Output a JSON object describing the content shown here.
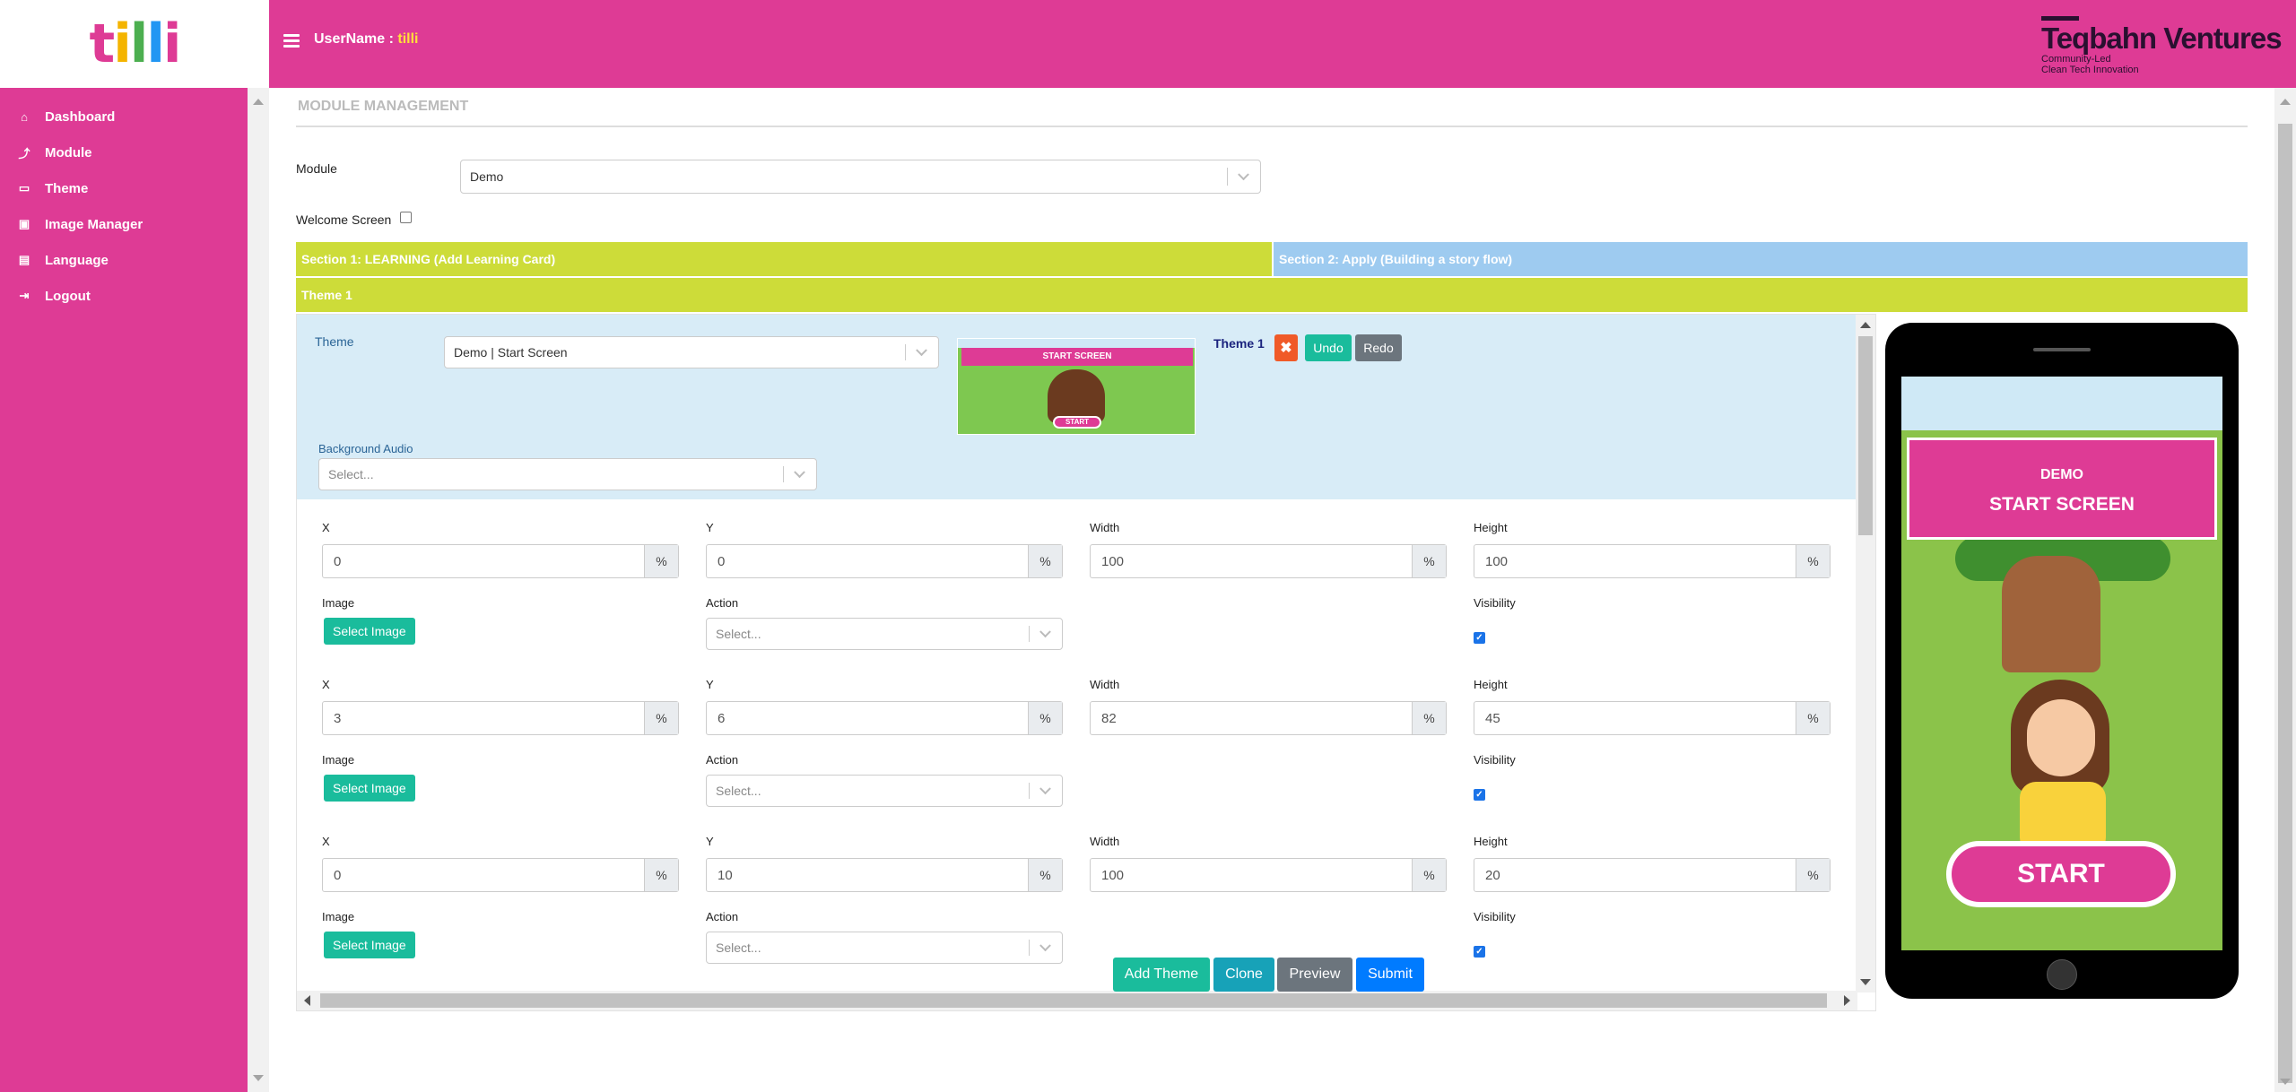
{
  "brand": {
    "logo_letters": [
      "t",
      "i",
      "l",
      "l",
      "i"
    ],
    "logo_colors": [
      "#de3b95",
      "#f4b400",
      "#4caf50",
      "#2196f3",
      "#de3b95"
    ],
    "company_name": "Teqbahn Ventures",
    "company_tagline_1": "Community-Led",
    "company_tagline_2": "Clean Tech Innovation"
  },
  "header": {
    "username_label": "UserName : ",
    "username_value": "tilli"
  },
  "sidebar": {
    "items": [
      {
        "label": "Dashboard",
        "icon": "home-icon"
      },
      {
        "label": "Module",
        "icon": "upload-icon"
      },
      {
        "label": "Theme",
        "icon": "monitor-icon"
      },
      {
        "label": "Image Manager",
        "icon": "image-icon"
      },
      {
        "label": "Language",
        "icon": "language-icon"
      },
      {
        "label": "Logout",
        "icon": "logout-icon"
      }
    ]
  },
  "page": {
    "title": "MODULE MANAGEMENT",
    "module_label": "Module",
    "module_value": "Demo",
    "welcome_label": "Welcome Screen",
    "welcome_checked": false,
    "section1": "Section 1: LEARNING (Add Learning Card)",
    "section2": "Section 2: Apply (Building a story flow)",
    "theme_tab": "Theme 1"
  },
  "editor": {
    "theme_label": "Theme",
    "theme_value": "Demo | Start Screen",
    "theme_name": "Theme 1",
    "delete_label": "✖",
    "undo_label": "Undo",
    "redo_label": "Redo",
    "bg_audio_label": "Background Audio",
    "bg_audio_placeholder": "Select...",
    "thumb_title": "START SCREEN",
    "thumb_start": "START",
    "field_labels": {
      "x": "X",
      "y": "Y",
      "width": "Width",
      "height": "Height",
      "image": "Image",
      "action": "Action",
      "visibility": "Visibility"
    },
    "pct": "%",
    "select_image": "Select Image",
    "action_placeholder": "Select...",
    "layers": [
      {
        "x": "0",
        "y": "0",
        "width": "100",
        "height": "100",
        "visible": true
      },
      {
        "x": "3",
        "y": "6",
        "width": "82",
        "height": "45",
        "visible": true
      },
      {
        "x": "0",
        "y": "10",
        "width": "100",
        "height": "20",
        "visible": true
      }
    ]
  },
  "preview": {
    "title_1": "DEMO",
    "title_2": "START SCREEN",
    "start": "START"
  },
  "actions": {
    "add_theme": "Add Theme",
    "clone": "Clone",
    "preview": "Preview",
    "submit": "Submit"
  }
}
